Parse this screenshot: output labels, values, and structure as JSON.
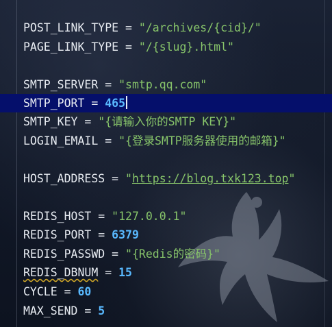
{
  "lines": [
    {
      "key": "POST_LINK_TYPE",
      "op": " = ",
      "value": "\"/archives/{cid}/\"",
      "kind": "str"
    },
    {
      "key": "PAGE_LINK_TYPE",
      "op": " = ",
      "value": "\"/{slug}.html\"",
      "kind": "str"
    },
    {
      "key": "SMTP_SERVER",
      "op": " = ",
      "value": "\"smtp.qq.com\"",
      "kind": "str"
    },
    {
      "key": "SMTP_PORT",
      "op": " = ",
      "value": "465",
      "kind": "num"
    },
    {
      "key": "SMTP_KEY",
      "op": " = ",
      "value": "\"{请输入你的SMTP KEY}\"",
      "kind": "str"
    },
    {
      "key": "LOGIN_EMAIL",
      "op": " = ",
      "value": "\"{登录SMTP服务器使用的邮箱}\"",
      "kind": "str"
    },
    {
      "key": "HOST_ADDRESS",
      "op": " = ",
      "value_open": "\"",
      "value": "https://blog.txk123.top",
      "value_close": "\"",
      "kind": "link"
    },
    {
      "key": "REDIS_HOST",
      "op": " = ",
      "value": "\"127.0.0.1\"",
      "kind": "str"
    },
    {
      "key": "REDIS_PORT",
      "op": " = ",
      "value": "6379",
      "kind": "num"
    },
    {
      "key": "REDIS_PASSWD",
      "op": " = ",
      "value": "\"{Redis的密码}\"",
      "kind": "str"
    },
    {
      "key": "REDIS_DBNUM",
      "op": " = ",
      "value": "15",
      "kind": "num"
    },
    {
      "key": "CYCLE",
      "op": " = ",
      "value": "60",
      "kind": "num"
    },
    {
      "key": "MAX_SEND",
      "op": " = ",
      "value": "5",
      "kind": "num"
    }
  ],
  "theme": {
    "background": "#111827",
    "active_line": "#050f6b",
    "key_color": "#e8ecf2",
    "string_color": "#87c46a",
    "number_color": "#59b9ff",
    "warning_underline": "#c9a227"
  }
}
